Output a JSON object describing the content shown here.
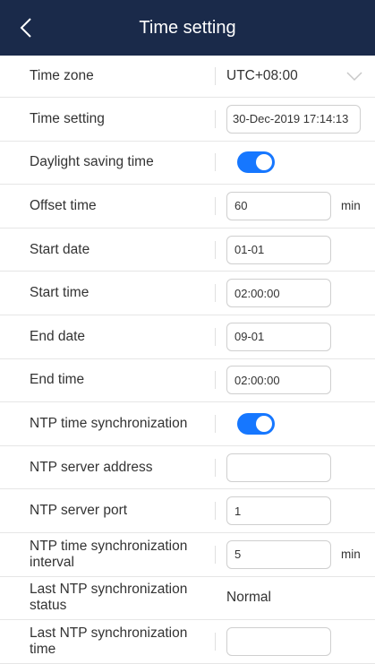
{
  "header": {
    "title": "Time setting",
    "back_icon": "chevron-left-icon"
  },
  "rows": {
    "time_zone": {
      "label": "Time zone",
      "value": "UTC+08:00"
    },
    "time_setting": {
      "label": "Time setting",
      "value": "30-Dec-2019 17:14:13"
    },
    "dst": {
      "label": "Daylight saving time",
      "enabled": true
    },
    "offset": {
      "label": "Offset time",
      "value": "60",
      "unit": "min"
    },
    "start_date": {
      "label": "Start date",
      "value": "01-01"
    },
    "start_time": {
      "label": "Start time",
      "value": "02:00:00"
    },
    "end_date": {
      "label": "End date",
      "value": "09-01"
    },
    "end_time": {
      "label": "End time",
      "value": "02:00:00"
    },
    "ntp_sync": {
      "label": "NTP time synchronization",
      "enabled": true
    },
    "ntp_address": {
      "label": "NTP server address",
      "value": ""
    },
    "ntp_port": {
      "label": "NTP server port",
      "value": "1"
    },
    "ntp_interval": {
      "label": "NTP time synchronization interval",
      "value": "5",
      "unit": "min"
    },
    "last_status": {
      "label": "Last NTP synchronization status",
      "value": "Normal"
    },
    "last_time": {
      "label": "Last NTP synchronization time",
      "value": ""
    }
  },
  "colors": {
    "header_bg": "#1a2a4a",
    "toggle_on": "#1677ff"
  }
}
